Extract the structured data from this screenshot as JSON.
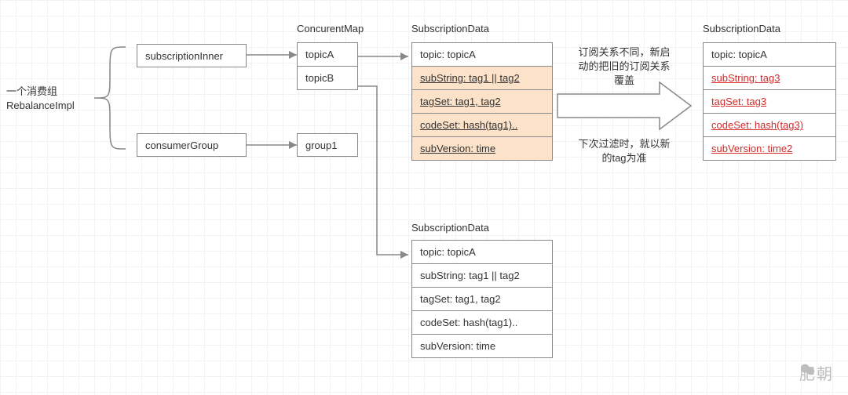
{
  "root_label": "一个消费组\nRebalanceImpl",
  "left_boxes": {
    "subscription_inner": "subscriptionInner",
    "consumer_group": "consumerGroup"
  },
  "map_title": "ConcurentMap",
  "map_rows": {
    "row0": "topicA",
    "row1": "topicB"
  },
  "group_value": "group1",
  "subdata_title": "SubscriptionData",
  "sd1": {
    "topic": "topic: topicA",
    "substring": "subString: tag1 || tag2",
    "tagset": "tagSet: tag1, tag2",
    "codeset": "codeSet: hash(tag1)..",
    "subversion": "subVersion: time"
  },
  "arrow_note_top": "订阅关系不同，新启\n动的把旧的订阅关系\n覆盖",
  "arrow_note_bottom": "下次过滤时，就以新\n的tag为准",
  "sd_right": {
    "topic": "topic: topicA",
    "substring": "subString: tag3",
    "tagset": "tagSet: tag3",
    "codeset": "codeSet: hash(tag3)",
    "subversion": "subVersion: time2"
  },
  "sd2": {
    "topic": "topic: topicA",
    "substring": "subString: tag1 || tag2",
    "tagset": "tagSet: tag1, tag2",
    "codeset": "codeSet: hash(tag1)..",
    "subversion": "subVersion: time"
  },
  "watermark": "肥朝"
}
